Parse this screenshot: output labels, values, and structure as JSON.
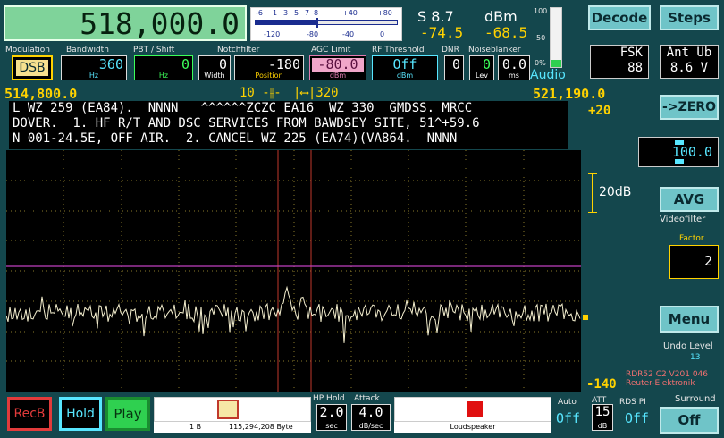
{
  "frequency": {
    "main": "518,000.0",
    "left": "514,800.0",
    "right": "521,190.0"
  },
  "smeter": {
    "scale_top": [
      "-6",
      "1",
      "3",
      "5",
      "7",
      "8",
      "+40",
      "+80"
    ],
    "scale_bottom": [
      "-120",
      "-80",
      "-40",
      "0"
    ],
    "s_label": "S 8.7",
    "dbm_label": "dBm",
    "val1": "-74.5",
    "val2": "-68.5"
  },
  "audio": {
    "label": "Audio",
    "scale": [
      "100",
      "50",
      "0%"
    ],
    "level": 0.12
  },
  "controls": {
    "modulation": {
      "label": "Modulation",
      "value": "DSB"
    },
    "bandwidth": {
      "label": "Bandwidth",
      "value": "360",
      "unit": "Hz"
    },
    "pbt": {
      "label": "PBT / Shift",
      "value": "0",
      "unit": "Hz"
    },
    "notch": {
      "label": "Notchfilter",
      "width_value": "0",
      "width_unit": "Width",
      "pos_value": "-180",
      "pos_unit": "Position"
    },
    "agc": {
      "label": "AGC Limit",
      "value": "-80.0",
      "unit": "dBm"
    },
    "rf": {
      "label": "RF Threshold",
      "value": "Off",
      "unit": "dBm"
    },
    "dnr": {
      "label": "DNR",
      "value": "0"
    },
    "nb": {
      "label": "Noiseblanker",
      "lev_value": "0",
      "lev_unit": "Lev",
      "ms_value": "0.0",
      "ms_unit": "ms"
    }
  },
  "passband": {
    "notch_label": "10",
    "width_label": "320"
  },
  "text_lines": [
    "L WZ 259 (EA84).  NNNN   ^^^^^^ZCZC EA16  WZ 330  GMDSS. MRCC",
    "DOVER.  1. HF R/T AND DSC SERVICES FROM BAWDSEY SITE, 51^+59.6",
    "N 001-24.5E, OFF AIR.  2. CANCEL WZ 225 (EA74)(VA864.  NNNN"
  ],
  "spectrum": {
    "top_label": "+20",
    "scale_label": "20dB",
    "bottom_label": "-140"
  },
  "right_panel": {
    "decode": "Decode",
    "steps": "Steps",
    "mode_name": "FSK",
    "mode_value": "88",
    "ant_name": "Ant Ub",
    "ant_value": "8.6 V",
    "zero": "->ZERO",
    "stepsize": "100.0",
    "avg": "AVG",
    "videofilter": "Videofilter",
    "factor_label": "Factor",
    "factor_value": "2",
    "menu": "Menu",
    "undo_label": "Undo Level",
    "undo_value": "13",
    "version": "RDR52 C2 V201 046",
    "vendor": "Reuter-Elektronik"
  },
  "bottom": {
    "rec": "RecB",
    "hold": "Hold",
    "play": "Play",
    "rec_info_left": "1 B",
    "rec_info_right": "115,294,208 Byte",
    "hp_hold_label": "HP Hold",
    "hp_hold_value": "2.0",
    "hp_hold_unit": "sec",
    "attack_label": "Attack",
    "attack_value": "4.0",
    "attack_unit": "dB/sec",
    "speaker_label": "Loudspeaker",
    "auto_label": "Auto",
    "auto_value": "Off",
    "att_label": "ATT",
    "att_value": "15",
    "att_unit": "dB",
    "rds_label": "RDS PI",
    "rds_value": "Off",
    "surround_label": "Surround",
    "surround_value": "Off"
  }
}
